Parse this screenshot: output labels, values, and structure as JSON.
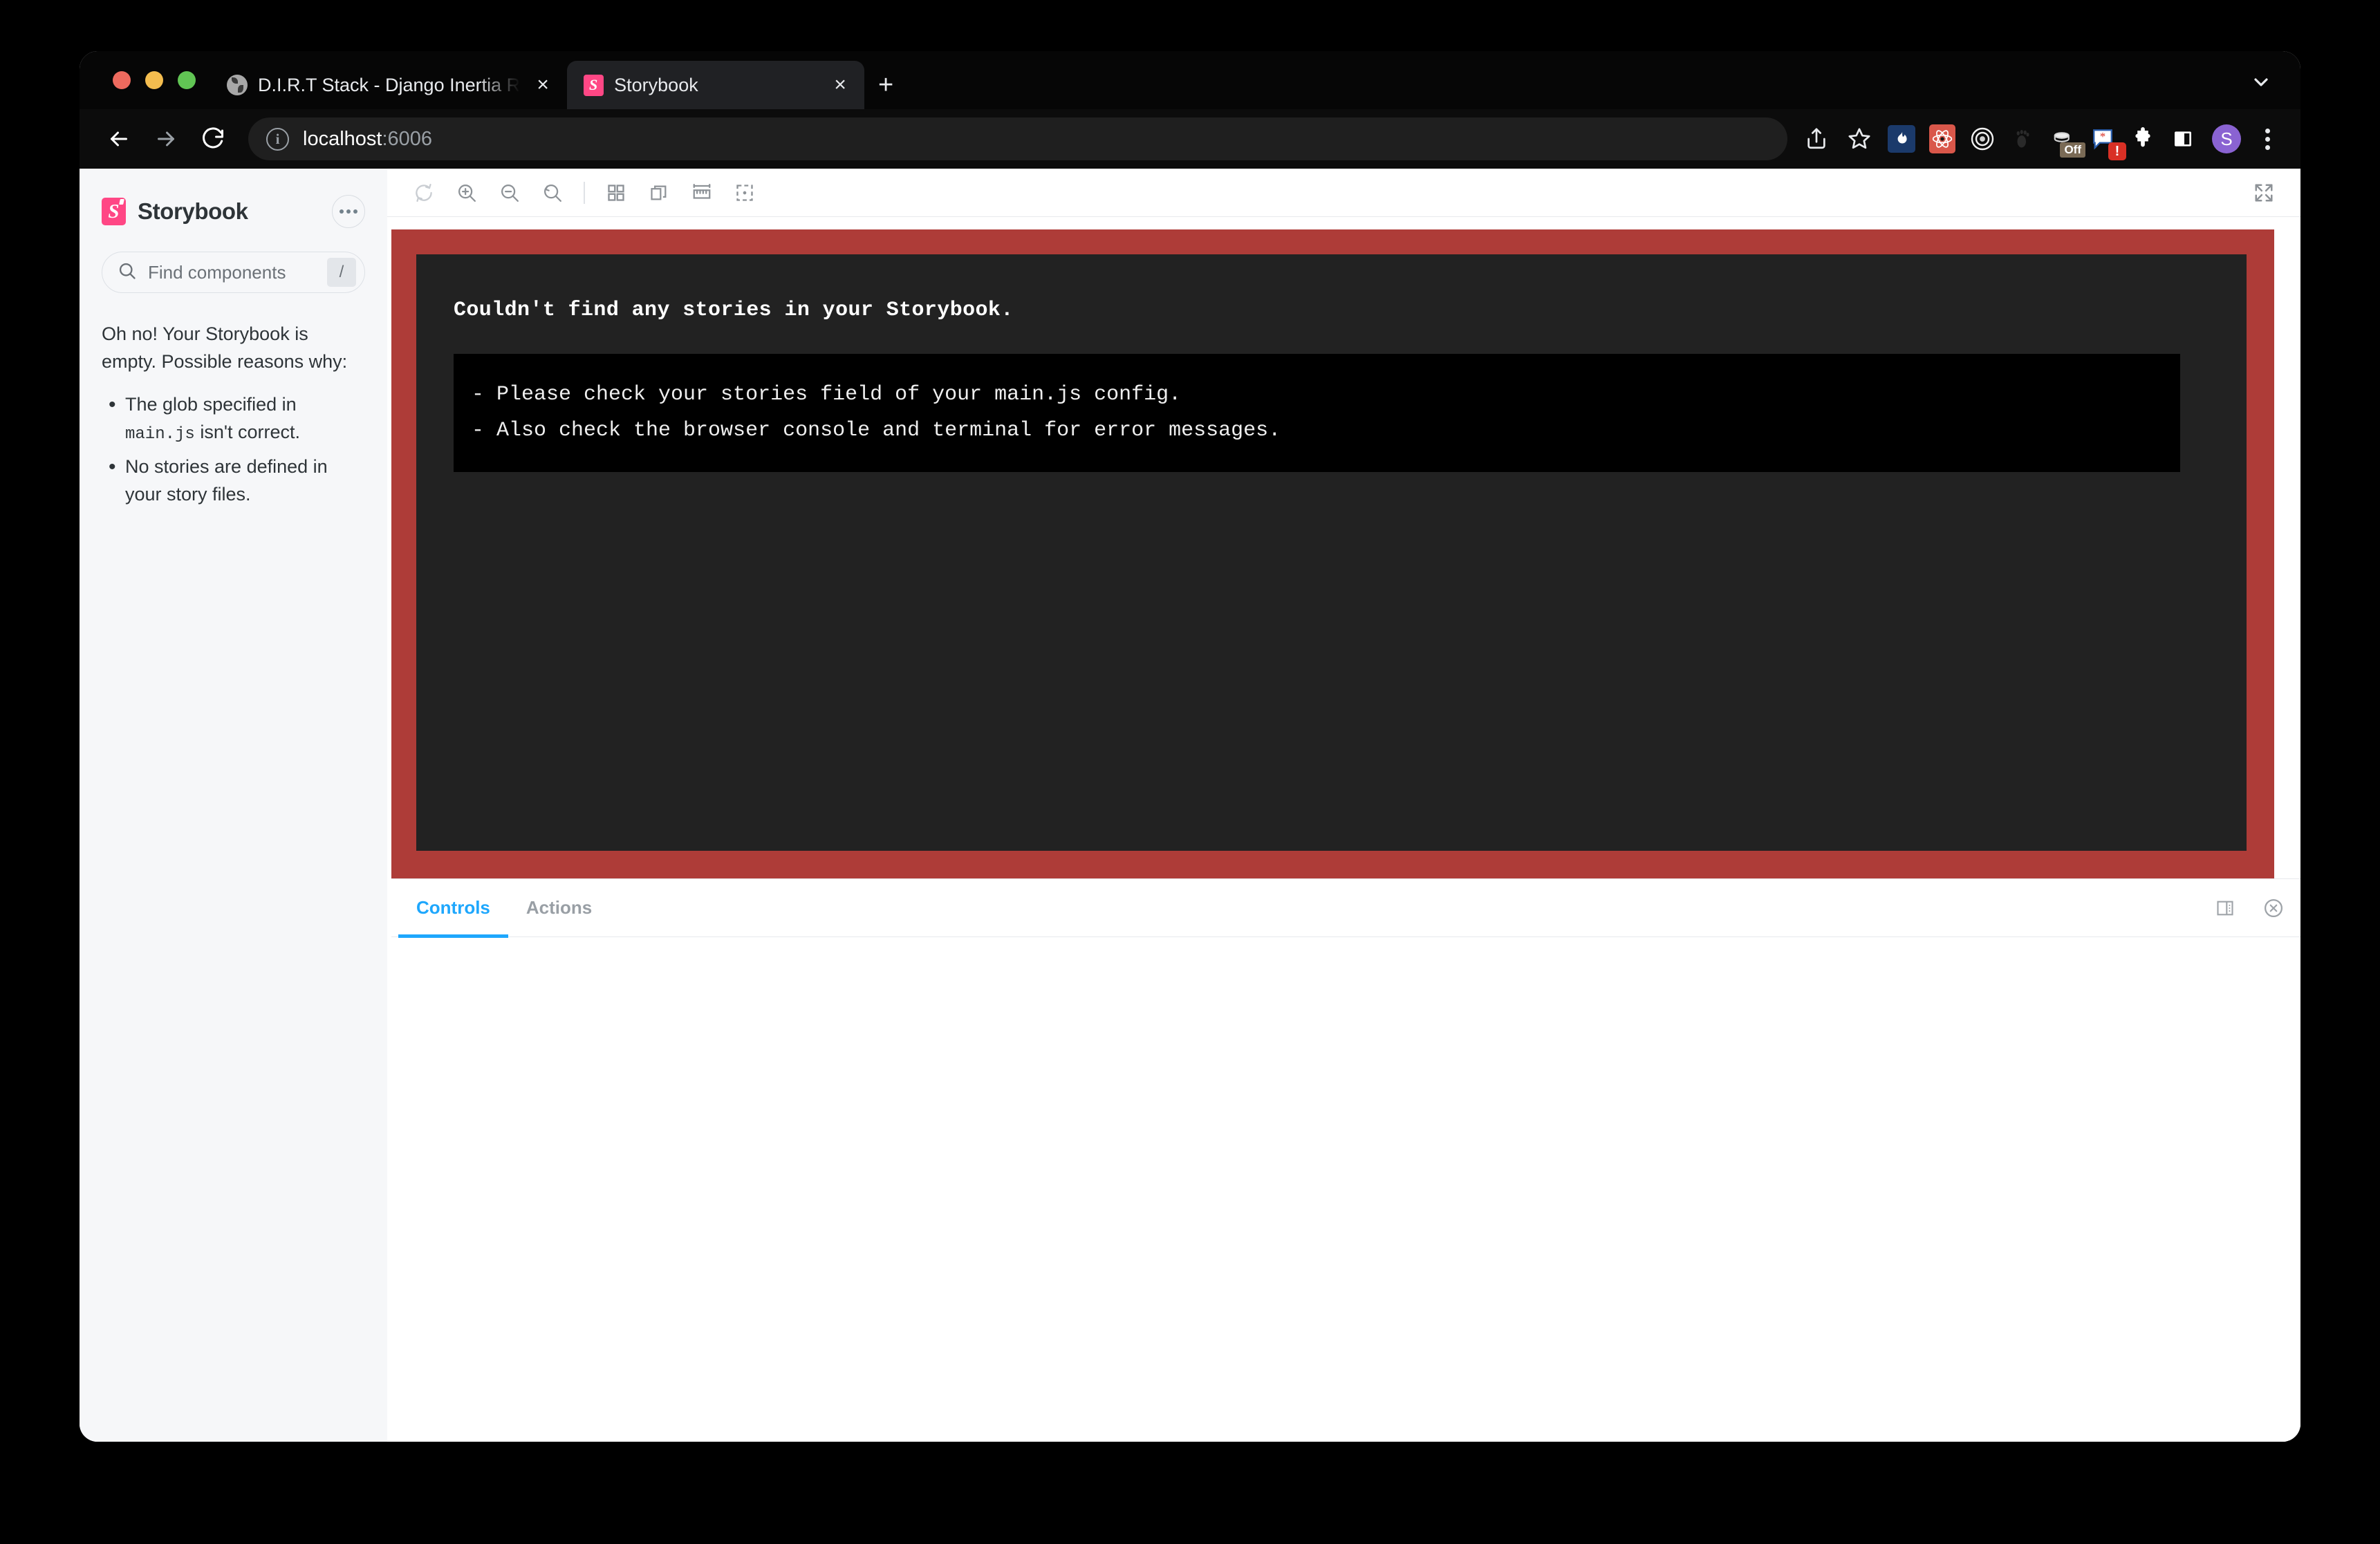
{
  "browser": {
    "tabs": [
      {
        "title": "D.I.R.T Stack - Django Inertia R",
        "favicon": "globe-icon",
        "active": false,
        "close_label": "×"
      },
      {
        "title": "Storybook",
        "favicon": "storybook-favicon",
        "active": true,
        "close_label": "×"
      }
    ],
    "new_tab_label": "+",
    "url": {
      "host": "localhost",
      "port": ":6006"
    },
    "toolbar_icons": [
      "share-icon",
      "bookmark-star-icon",
      "flame-extension-icon",
      "react-devtools-icon",
      "target-extension-icon",
      "footprint-extension-icon",
      "coffee-extension-icon",
      "speech-bubble-extension-icon",
      "puzzle-extensions-icon",
      "side-panel-icon",
      "profile-avatar",
      "browser-menu-icon"
    ],
    "coffee_badge": "Off",
    "bubble_badge": "!",
    "avatar_initial": "S"
  },
  "sidebar": {
    "brand": "Storybook",
    "logo_letter": "S",
    "menu_label": "•••",
    "search": {
      "placeholder": "Find components",
      "shortcut": "/"
    },
    "empty_heading": "Oh no! Your Storybook is empty. Possible reasons why:",
    "reasons": [
      {
        "prefix": "The glob specified in ",
        "code": "main.js",
        "suffix": " isn't correct."
      },
      {
        "prefix": "No stories are defined in your story files.",
        "code": "",
        "suffix": ""
      }
    ]
  },
  "preview": {
    "toolbar_icons": [
      "refresh-icon",
      "zoom-in-icon",
      "zoom-out-icon",
      "zoom-reset-icon",
      "grid-icon",
      "backgrounds-icon",
      "measure-icon",
      "outline-icon"
    ],
    "fullscreen_icon": "fullscreen-icon",
    "error_title": "Couldn't find any stories in your Storybook.",
    "error_lines": [
      "- Please check your stories field of your main.js config.",
      "- Also check the browser console and terminal for error messages."
    ],
    "frame_color": "#AE3C38",
    "panel_color": "#222222"
  },
  "addon_panel": {
    "tabs": [
      {
        "label": "Controls",
        "active": true
      },
      {
        "label": "Actions",
        "active": false
      }
    ],
    "actions": [
      "panel-position-icon",
      "close-panel-icon"
    ],
    "accent_color": "#1EA7FD"
  }
}
